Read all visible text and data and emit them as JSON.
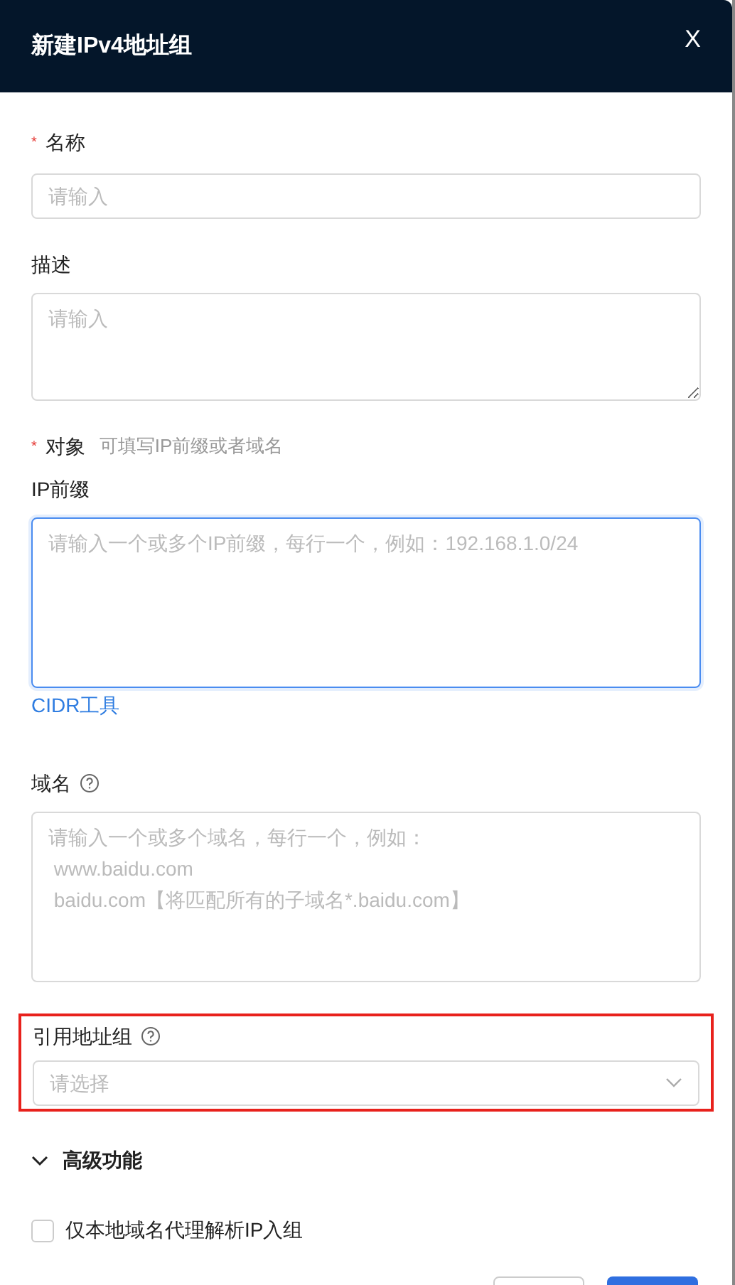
{
  "dialog": {
    "title": "新建IPv4地址组",
    "close": "X"
  },
  "fields": [
    {
      "kind": "input",
      "required_mark": "*",
      "label": "名称",
      "placeholder": "请输入"
    },
    {
      "kind": "textarea",
      "label": "描述",
      "placeholder": "请输入",
      "focused": false
    },
    {
      "kind": "section",
      "required_mark": "*",
      "label": "对象",
      "hint": "可填写IP前缀或者域名"
    },
    {
      "kind": "large-textarea",
      "label": "IP前缀",
      "placeholder": "请输入一个或多个IP前缀，每行一个，例如：192.168.1.0/24",
      "focused": true,
      "link": "CIDR工具"
    },
    {
      "kind": "large-textarea",
      "label": "域名",
      "help": true,
      "placeholder": "请输入一个或多个域名，每行一个，例如：\n www.baidu.com\n baidu.com【将匹配所有的子域名*.baidu.com】",
      "focused": false
    },
    {
      "kind": "select",
      "label": "引用地址组",
      "help": true,
      "placeholder": "请选择",
      "highlighted": true
    }
  ],
  "advanced": {
    "label": "高级功能",
    "expanded": true,
    "options": [
      {
        "label": "仅本地域名代理解析IP入组",
        "checked": false
      }
    ]
  },
  "footer": {
    "buttons": [
      {
        "kind": "secondary"
      },
      {
        "kind": "primary"
      }
    ]
  }
}
